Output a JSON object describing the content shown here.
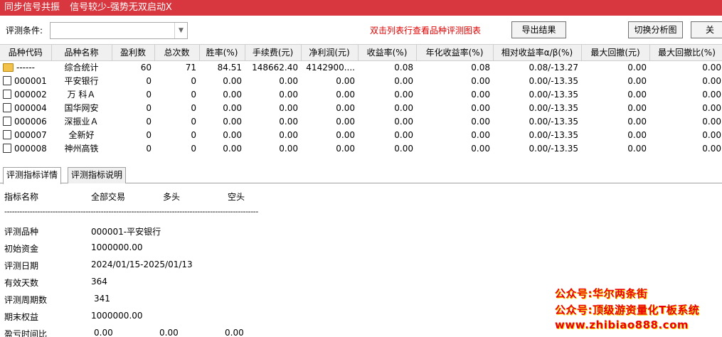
{
  "window": {
    "title_parts": [
      "同步信号共振",
      "信号较少-强势无双启动X"
    ]
  },
  "toolbar": {
    "condition_label": "评测条件:",
    "condition_value": "",
    "hint": "双击列表行查看品种评测图表",
    "export_label": "导出结果",
    "switch_label": "切换分析图",
    "close_label": "关"
  },
  "table": {
    "columns": [
      "品种代码",
      "品种名称",
      "盈利数",
      "总次数",
      "胜率(%)",
      "手续费(元)",
      "净利润(元)",
      "收益率(%)",
      "年化收益率(%)",
      "相对收益率α/β(%)",
      "最大回撤(元)",
      "最大回撤比(%)"
    ],
    "rows": [
      {
        "icon": "folder-icon",
        "code": "------",
        "name": "综合统计",
        "wins": "60",
        "total": "71",
        "winrate": "84.51",
        "fee": "148662.40",
        "profit": "4142900....",
        "ret": "0.08",
        "annual": "0.08",
        "rel": "0.08/-13.27",
        "maxdd": "0.00",
        "maxddr": "0.00"
      },
      {
        "icon": "document-icon",
        "code": "000001",
        "name": "平安银行",
        "wins": "0",
        "total": "0",
        "winrate": "0.00",
        "fee": "0.00",
        "profit": "0.00",
        "ret": "0.00",
        "annual": "0.00",
        "rel": "0.00/-13.35",
        "maxdd": "0.00",
        "maxddr": "0.00"
      },
      {
        "icon": "document-icon",
        "code": "000002",
        "name": "万 科Ａ",
        "wins": "0",
        "total": "0",
        "winrate": "0.00",
        "fee": "0.00",
        "profit": "0.00",
        "ret": "0.00",
        "annual": "0.00",
        "rel": "0.00/-13.35",
        "maxdd": "0.00",
        "maxddr": "0.00"
      },
      {
        "icon": "document-icon",
        "code": "000004",
        "name": "国华网安",
        "wins": "0",
        "total": "0",
        "winrate": "0.00",
        "fee": "0.00",
        "profit": "0.00",
        "ret": "0.00",
        "annual": "0.00",
        "rel": "0.00/-13.35",
        "maxdd": "0.00",
        "maxddr": "0.00"
      },
      {
        "icon": "document-icon",
        "code": "000006",
        "name": "深振业Ａ",
        "wins": "0",
        "total": "0",
        "winrate": "0.00",
        "fee": "0.00",
        "profit": "0.00",
        "ret": "0.00",
        "annual": "0.00",
        "rel": "0.00/-13.35",
        "maxdd": "0.00",
        "maxddr": "0.00"
      },
      {
        "icon": "document-icon",
        "code": "000007",
        "name": "全新好",
        "wins": "0",
        "total": "0",
        "winrate": "0.00",
        "fee": "0.00",
        "profit": "0.00",
        "ret": "0.00",
        "annual": "0.00",
        "rel": "0.00/-13.35",
        "maxdd": "0.00",
        "maxddr": "0.00"
      },
      {
        "icon": "document-icon",
        "code": "000008",
        "name": "神州高铁",
        "wins": "0",
        "total": "0",
        "winrate": "0.00",
        "fee": "0.00",
        "profit": "0.00",
        "ret": "0.00",
        "annual": "0.00",
        "rel": "0.00/-13.35",
        "maxdd": "0.00",
        "maxddr": "0.00"
      }
    ]
  },
  "tabs": [
    "评测指标详情",
    "评测指标说明"
  ],
  "detail": {
    "headers": [
      "指标名称",
      "全部交易",
      "多头",
      "空头"
    ],
    "separator": "----------------------------------------------------------------------------------------------------",
    "items": [
      {
        "label": "评测品种",
        "value": "000001-平安银行"
      },
      {
        "label": "初始资金",
        "value": "1000000.00"
      },
      {
        "label": "评测日期",
        "value": "2024/01/15-2025/01/13"
      },
      {
        "label": "有效天数",
        "value": "364"
      },
      {
        "label": "评测周期数",
        "value": "341"
      },
      {
        "label": "期末权益",
        "value": "1000000.00"
      }
    ],
    "ratio_row": {
      "label": "盈亏时间比",
      "values": [
        "0.00",
        "0.00",
        "0.00"
      ]
    }
  },
  "watermark": {
    "lines": [
      "公众号:华尔两条街",
      "公众号:顶级游资量化T板系统",
      "www.zhibiao888.com"
    ],
    "color": "#e8000b"
  },
  "colors": {
    "title_bar": "#d9373f",
    "hint": "#e00000"
  }
}
